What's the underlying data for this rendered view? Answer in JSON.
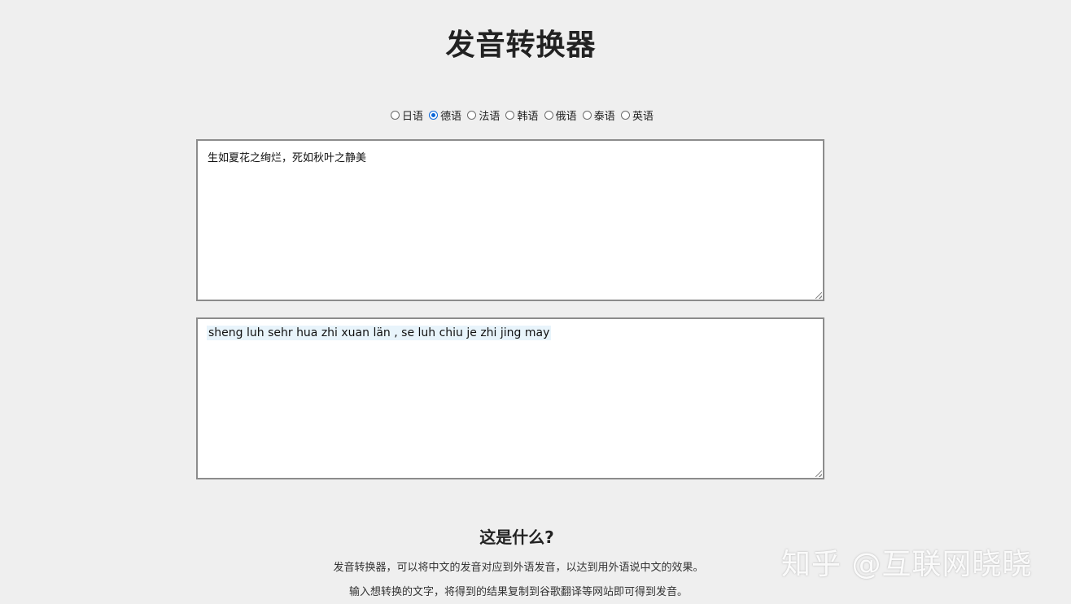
{
  "header": {
    "title": "发音转换器"
  },
  "languages": {
    "options": [
      {
        "label": "日语",
        "checked": false
      },
      {
        "label": "德语",
        "checked": true
      },
      {
        "label": "法语",
        "checked": false
      },
      {
        "label": "韩语",
        "checked": false
      },
      {
        "label": "俄语",
        "checked": false
      },
      {
        "label": "泰语",
        "checked": false
      },
      {
        "label": "英语",
        "checked": false
      }
    ]
  },
  "input": {
    "value": "生如夏花之绚烂，死如秋叶之静美"
  },
  "output": {
    "value": "sheng luh sehr hua zhi xuan län , se luh chiu je zhi jing may"
  },
  "about": {
    "title": "这是什么?",
    "line1": "发音转换器，可以将中文的发音对应到外语发音，以达到用外语说中文的效果。",
    "line2": "输入想转换的文字，将得到的结果复制到谷歌翻译等网站即可得到发音。"
  },
  "watermark": {
    "text": "知乎 @互联网晓晓"
  },
  "colors": {
    "background": "#efefef",
    "radio_accent": "#0a66d8",
    "highlight": "#e8f4fb"
  }
}
